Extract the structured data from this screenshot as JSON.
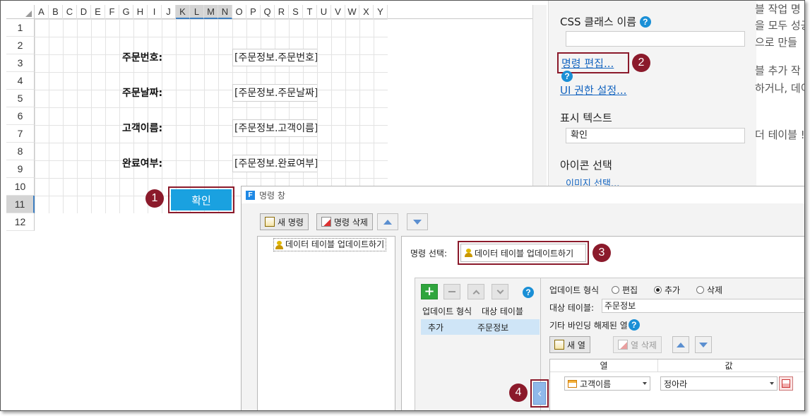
{
  "sheet": {
    "columns": [
      "A",
      "B",
      "C",
      "D",
      "E",
      "F",
      "G",
      "H",
      "I",
      "J",
      "K",
      "L",
      "M",
      "N",
      "O",
      "P",
      "Q",
      "R",
      "S",
      "T",
      "U",
      "V",
      "W",
      "X",
      "Y"
    ],
    "rows": [
      "1",
      "2",
      "3",
      "4",
      "5",
      "6",
      "7",
      "8",
      "9",
      "10",
      "11",
      "12"
    ],
    "labels": {
      "order_no": "주문번호:",
      "order_date": "주문날짜:",
      "customer": "고객이름:",
      "complete": "완료여부:"
    },
    "fields": {
      "order_no": "[주문정보.주문번호]",
      "order_date": "[주문정보.주문날짜]",
      "customer": "[주문정보.고객이름]",
      "complete": "[주문정보.완료여부]"
    },
    "confirm_button": "확인"
  },
  "props": {
    "css_class_label": "CSS 클래스 이름",
    "css_class_value": "",
    "edit_command_link": "명령 편집...",
    "ui_permission_link": "UI 권한 설정...",
    "display_text_label": "표시 텍스트",
    "display_text_value": "확인",
    "icon_select_label": "아이콘 선택",
    "image_select_link": "이미지 선택..."
  },
  "background_text": [
    "블 작업 명",
    "을 모두 성공",
    "으로 만들",
    "블 추가 작",
    "하거나, 데이",
    "더 테이블 !"
  ],
  "callouts": [
    "1",
    "2",
    "3",
    "4"
  ],
  "command_window": {
    "title": "명령 창",
    "toolbar": {
      "new_command": "새 명령",
      "delete_command": "명령 삭제"
    },
    "command_list": [
      "데이터 테이블 업데이트하기"
    ],
    "command_select_label": "명령 선택:",
    "command_select_value": "데이터 테이블 업데이트하기",
    "update_list": {
      "headers": [
        "업데이트 형식",
        "대상 테이블"
      ],
      "rows": [
        [
          "추가",
          "주문정보"
        ]
      ]
    },
    "update_type_label": "업데이트 형식",
    "update_type_options": [
      "편집",
      "추가",
      "삭제"
    ],
    "update_type_selected": "추가",
    "target_table_label": "대상 테이블:",
    "target_table_value": "주문정보",
    "unbound_columns_label": "기타 바인딩 해제된 열",
    "new_column_button": "새 열",
    "delete_column_button": "열 삭제",
    "grid_headers": [
      "열",
      "값"
    ],
    "grid_rows": [
      [
        "고객이름",
        "정아라"
      ]
    ]
  }
}
